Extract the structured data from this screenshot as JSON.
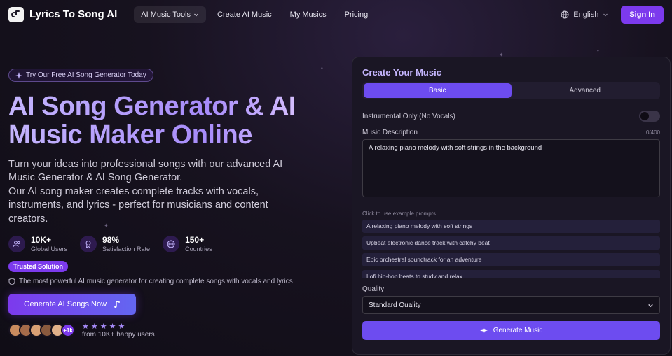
{
  "header": {
    "brand": "Lyrics To Song AI",
    "nav": [
      {
        "label": "AI Music Tools",
        "active": true,
        "dropdown": true
      },
      {
        "label": "Create AI Music",
        "active": false
      },
      {
        "label": "My Musics",
        "active": false
      },
      {
        "label": "Pricing",
        "active": false
      }
    ],
    "language": "English",
    "signin": "Sign In"
  },
  "hero": {
    "badge": "Try Our Free AI Song Generator Today",
    "title_line1": "AI Song Generator & AI",
    "title_line2": "Music Maker Online",
    "desc_line1": "Turn your ideas into professional songs with our advanced AI",
    "desc_line2": "Music Generator & AI Song Generator.",
    "desc_line3": "Our AI song maker creates complete tracks with vocals,",
    "desc_line4": "instruments, and lyrics - perfect for musicians and content",
    "desc_line5": "creators.",
    "stats": [
      {
        "value": "10K+",
        "label": "Global Users",
        "icon": "users-icon"
      },
      {
        "value": "98%",
        "label": "Satisfaction Rate",
        "icon": "award-icon"
      },
      {
        "value": "150+",
        "label": "Countries",
        "icon": "globe-icon"
      }
    ],
    "trusted_badge": "Trusted Solution",
    "trusted_text": "The most powerful AI music generator for creating complete songs with vocals and lyrics",
    "cta": "Generate AI Songs Now",
    "avatar_more": "+1k",
    "stars": "★★★★★",
    "happy_users": "from 10K+ happy users"
  },
  "card": {
    "title": "Create Your Music",
    "tabs": [
      {
        "label": "Basic",
        "active": true
      },
      {
        "label": "Advanced",
        "active": false
      }
    ],
    "instrumental_label": "Instrumental Only (No Vocals)",
    "description_label": "Music Description",
    "counter": "0/400",
    "description_value": "A relaxing piano melody with soft strings in the background",
    "examples_label": "Click to use example prompts",
    "examples": [
      "A relaxing piano melody with soft strings",
      "Upbeat electronic dance track with catchy beat",
      "Epic orchestral soundtrack for an adventure",
      "Lofi hip-hop beats to study and relax"
    ],
    "quality_label": "Quality",
    "quality_value": "Standard Quality",
    "generate": "Generate Music"
  },
  "colors": {
    "accent": "#7c3aed",
    "button": "#6d4cf0",
    "title_gradient_start": "#c4b5fd"
  }
}
